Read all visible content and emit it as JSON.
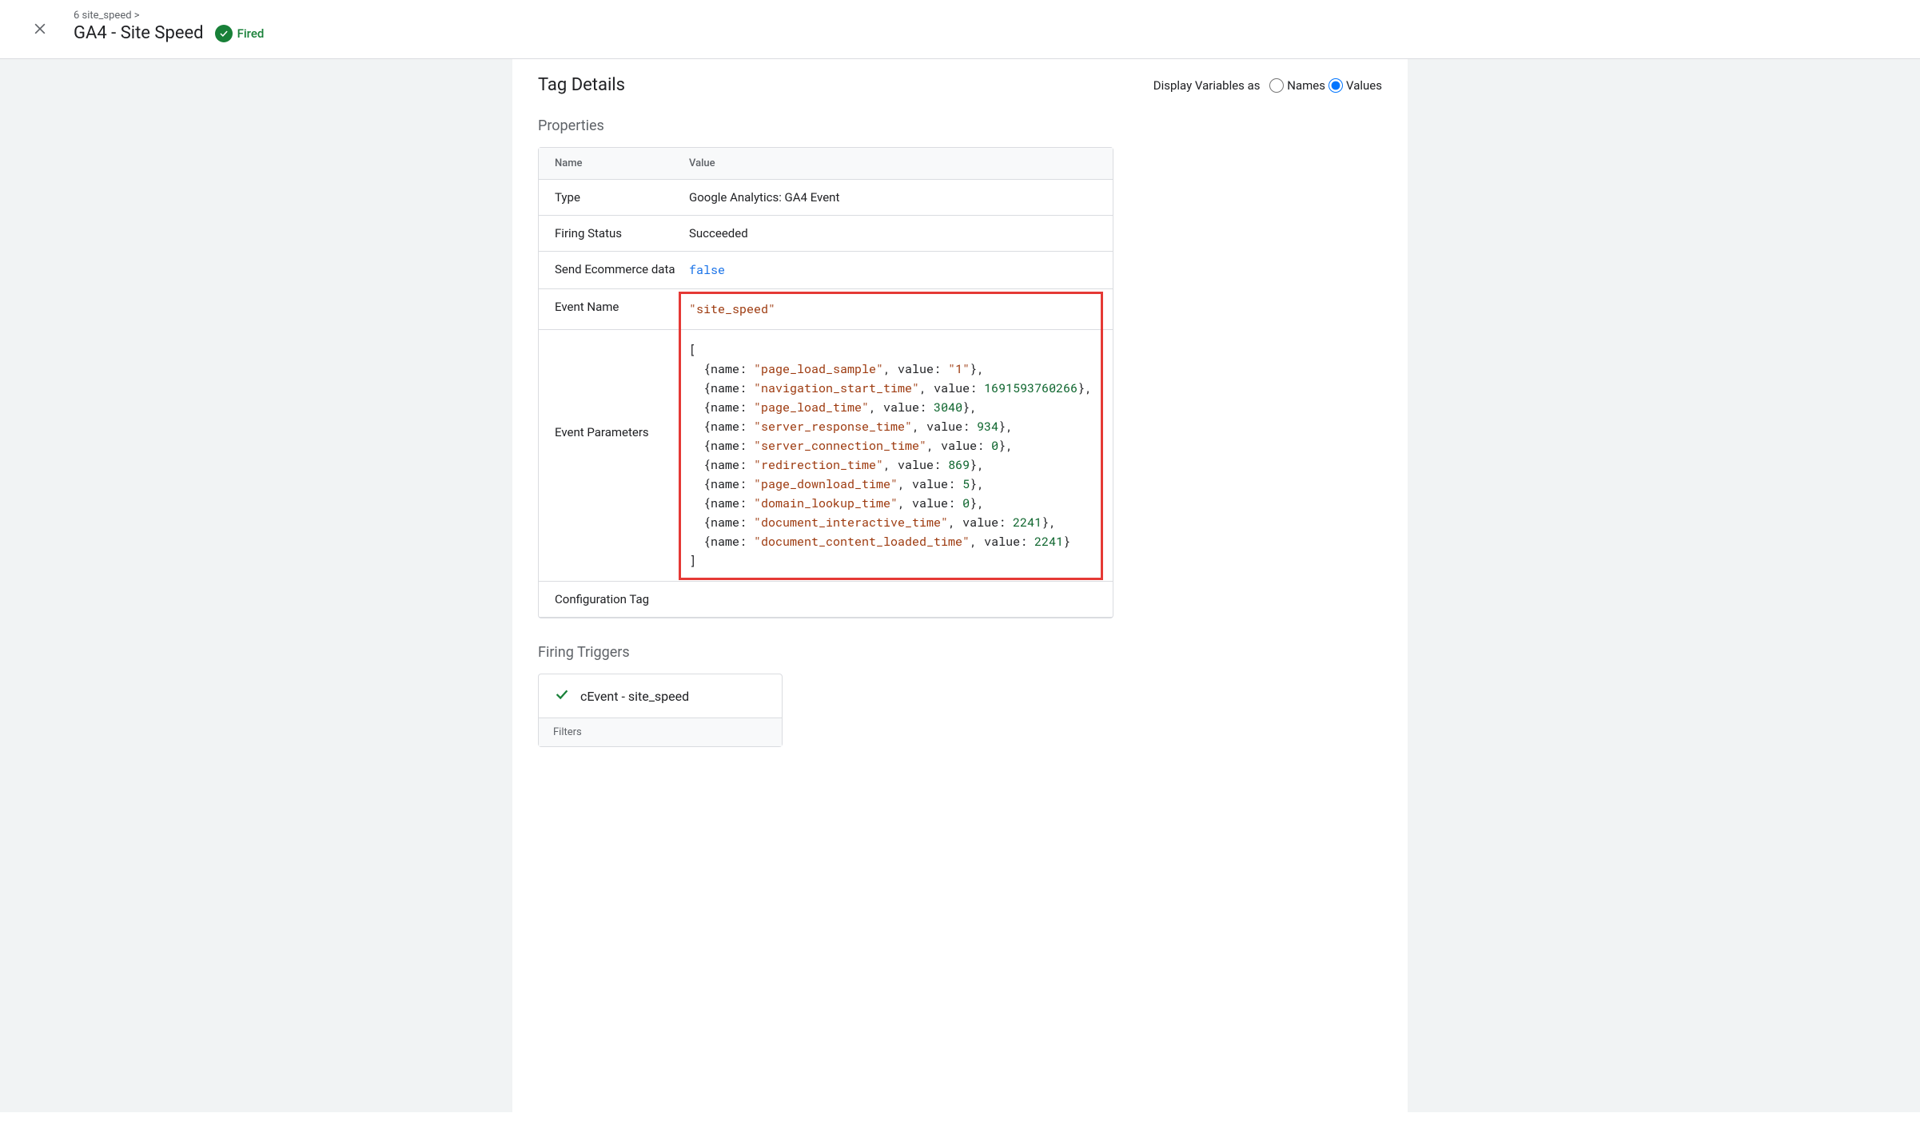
{
  "header": {
    "breadcrumb": "6 site_speed >",
    "title": "GA4 - Site Speed",
    "status": "Fired"
  },
  "details": {
    "title": "Tag Details",
    "display_label": "Display Variables as",
    "display_options": {
      "names": "Names",
      "values": "Values"
    }
  },
  "properties": {
    "section_title": "Properties",
    "headers": {
      "name": "Name",
      "value": "Value"
    },
    "rows": {
      "type": {
        "name": "Type",
        "value": "Google Analytics: GA4 Event"
      },
      "firing_status": {
        "name": "Firing Status",
        "value": "Succeeded"
      },
      "ecommerce": {
        "name": "Send Ecommerce data",
        "value": "false"
      },
      "event_name": {
        "name": "Event Name",
        "value": "\"site_speed\""
      },
      "event_params": {
        "name": "Event Parameters"
      },
      "config_tag": {
        "name": "Configuration Tag",
        "value": ""
      }
    }
  },
  "event_parameters": [
    {
      "name": "page_load_sample",
      "value": "1",
      "is_string": true
    },
    {
      "name": "navigation_start_time",
      "value": "1691593760266",
      "is_string": false
    },
    {
      "name": "page_load_time",
      "value": "3040",
      "is_string": false
    },
    {
      "name": "server_response_time",
      "value": "934",
      "is_string": false
    },
    {
      "name": "server_connection_time",
      "value": "0",
      "is_string": false
    },
    {
      "name": "redirection_time",
      "value": "869",
      "is_string": false
    },
    {
      "name": "page_download_time",
      "value": "5",
      "is_string": false
    },
    {
      "name": "domain_lookup_time",
      "value": "0",
      "is_string": false
    },
    {
      "name": "document_interactive_time",
      "value": "2241",
      "is_string": false
    },
    {
      "name": "document_content_loaded_time",
      "value": "2241",
      "is_string": false
    }
  ],
  "triggers": {
    "section_title": "Firing Triggers",
    "items": [
      {
        "name": "cEvent - site_speed"
      }
    ],
    "filters_label": "Filters"
  }
}
